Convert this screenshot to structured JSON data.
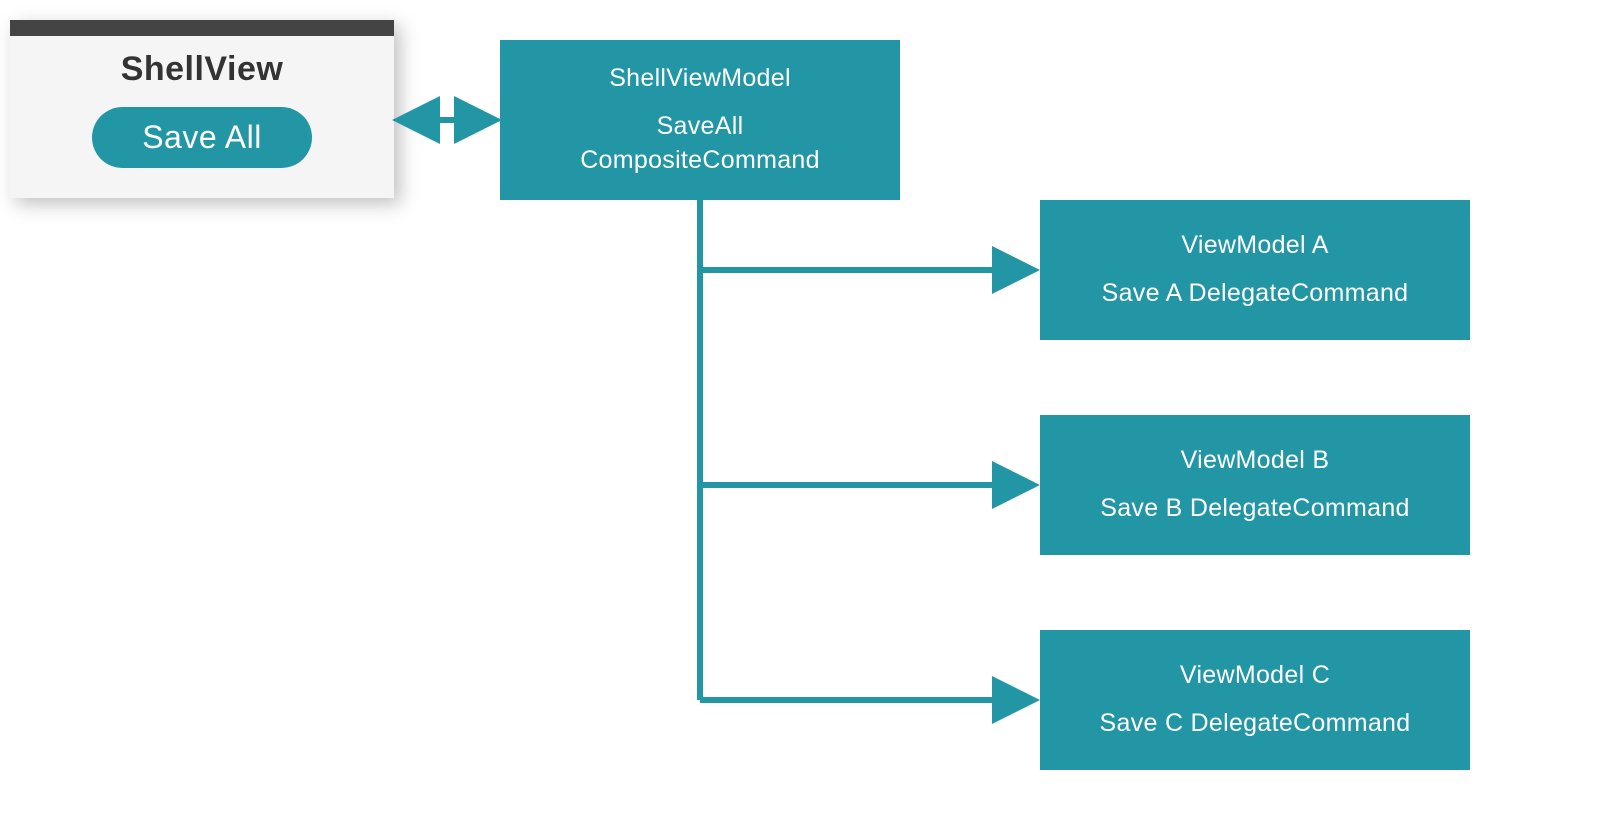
{
  "colors": {
    "teal": "#2396a6",
    "titlebar": "#444444",
    "windowBg": "#f5f5f5"
  },
  "shellView": {
    "title": "ShellView",
    "button": "Save All"
  },
  "shellViewModel": {
    "title": "ShellViewModel",
    "line1": "SaveAll",
    "line2": "CompositeCommand"
  },
  "viewModels": [
    {
      "title": "ViewModel A",
      "command": "Save A DelegateCommand"
    },
    {
      "title": "ViewModel B",
      "command": "Save B DelegateCommand"
    },
    {
      "title": "ViewModel C",
      "command": "Save C DelegateCommand"
    }
  ]
}
